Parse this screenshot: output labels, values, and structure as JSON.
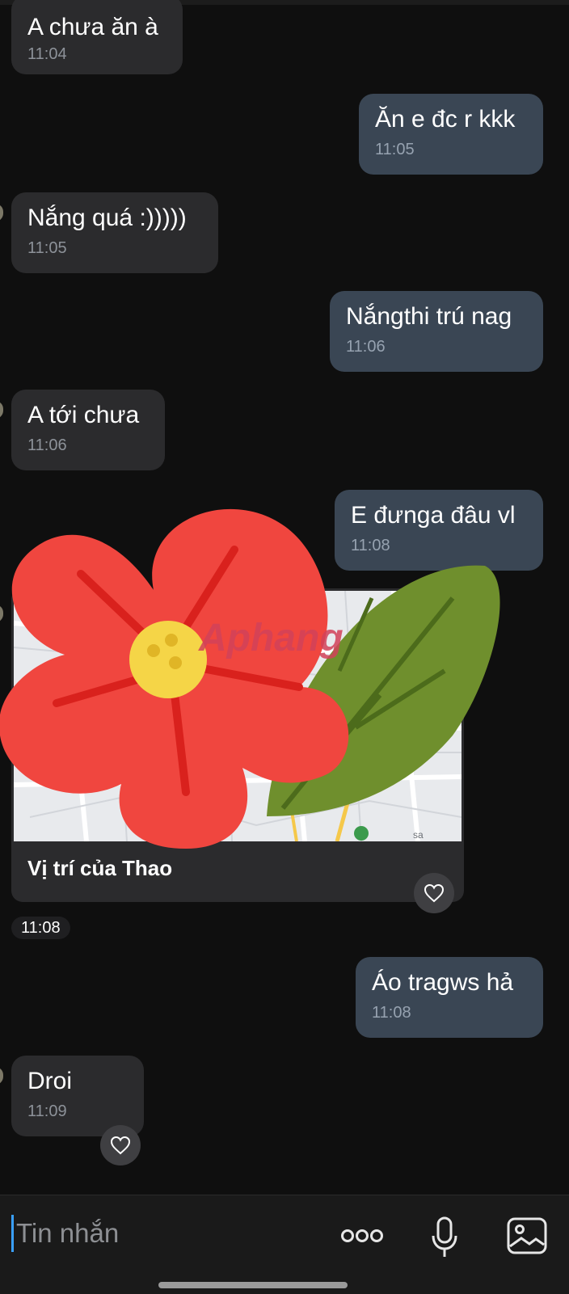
{
  "messages": [
    {
      "side": "in",
      "text": "A chưa ăn à",
      "time": "11:04"
    },
    {
      "side": "out",
      "text": "Ăn e đc r kkk",
      "time": "11:05"
    },
    {
      "side": "in",
      "text": "Nắng quá :)))))",
      "time": "11:05"
    },
    {
      "side": "out",
      "text": "Nắngthi trú nag",
      "time": "11:06"
    },
    {
      "side": "in",
      "text": "A tới chưa",
      "time": "11:06"
    },
    {
      "side": "out",
      "text": "E đưnga đâu vl",
      "time": "11:08"
    },
    {
      "side": "out",
      "text": "Áo tragws hả",
      "time": "11:08"
    },
    {
      "side": "in",
      "text": "Droi",
      "time": "11:09"
    }
  ],
  "location_card": {
    "title": "Vị trí của Thao",
    "time": "11:08",
    "map_label": "sa"
  },
  "sticker": {
    "watermark": "Aphang",
    "colors": {
      "petal": "#f0463f",
      "vein": "#d9211d",
      "center": "#f5d547",
      "leaf": "#6f8f2d",
      "leaf_vein": "#4c6b1b"
    }
  },
  "composer": {
    "placeholder": "Tin nhắn",
    "more_icon": "more-dots-icon",
    "mic_icon": "microphone-icon",
    "image_icon": "image-icon"
  },
  "colors": {
    "background": "#0f0f0f",
    "bubble_in": "#2b2b2d",
    "bubble_out": "#3a4654",
    "caret": "#3aa0ff"
  }
}
